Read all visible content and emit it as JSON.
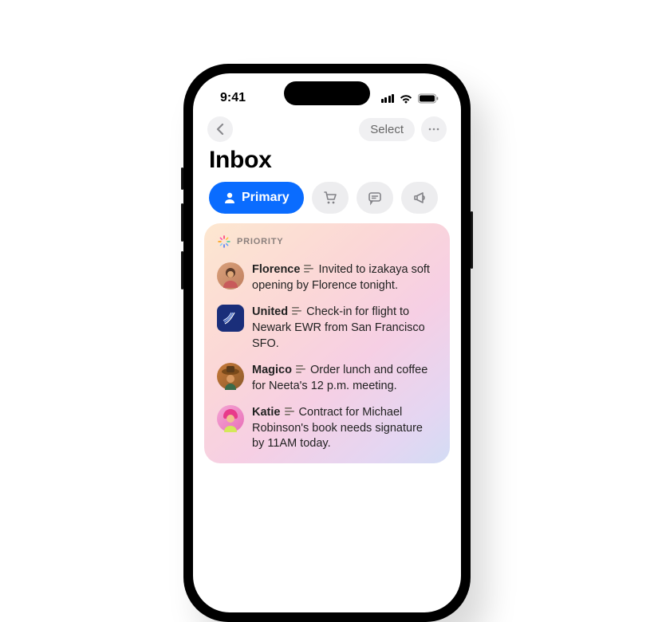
{
  "status": {
    "time": "9:41"
  },
  "nav": {
    "select_label": "Select"
  },
  "page_title": "Inbox",
  "tabs": {
    "primary_label": "Primary"
  },
  "priority": {
    "label": "PRIORITY",
    "items": [
      {
        "sender": "Florence",
        "text": "Invited to izakaya soft opening by Florence tonight."
      },
      {
        "sender": "United",
        "text": "Check-in for flight to Newark EWR from San Francisco SFO."
      },
      {
        "sender": "Magico",
        "text": "Order lunch and coffee for Neeta's 12 p.m. meeting."
      },
      {
        "sender": "Katie",
        "text": "Contract for Michael Robinson's book needs signature by 11AM today."
      }
    ]
  }
}
